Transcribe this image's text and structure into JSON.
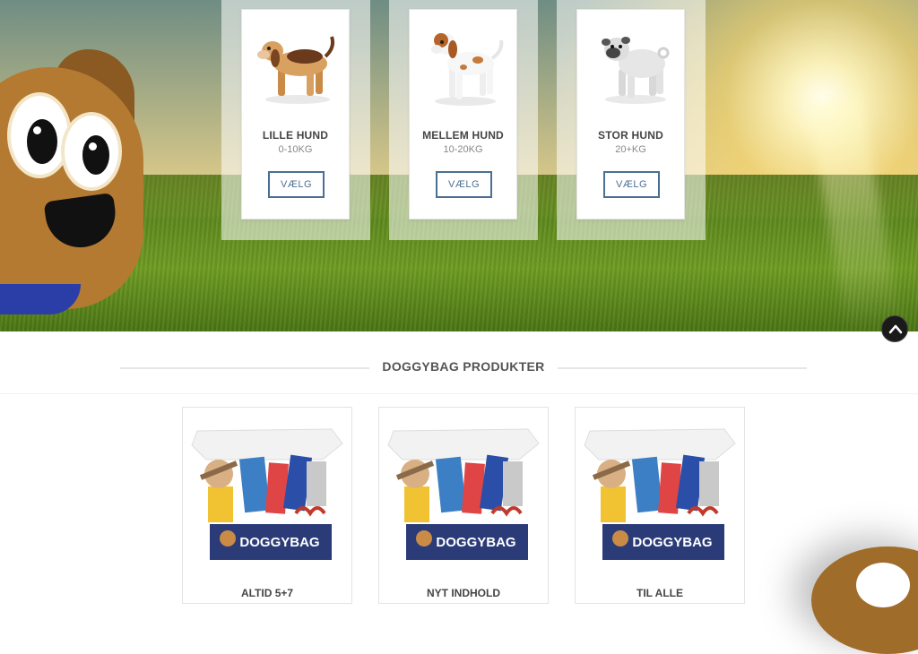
{
  "hero": {
    "sizes": [
      {
        "name": "LILLE HUND",
        "weight": "0-10KG",
        "button": "VÆLG",
        "dog": "beagle-icon"
      },
      {
        "name": "MELLEM HUND",
        "weight": "10-20KG",
        "button": "VÆLG",
        "dog": "spaniel-icon"
      },
      {
        "name": "STOR HUND",
        "weight": "20+KG",
        "button": "VÆLG",
        "dog": "pug-icon"
      }
    ]
  },
  "scroll_top": {
    "icon": "chevron-up-icon"
  },
  "products_section": {
    "title": "DOGGYBAG PRODUKTER",
    "items": [
      {
        "caption": "ALTID 5+7",
        "brand": "DOGGYBAG"
      },
      {
        "caption": "NYT INDHOLD",
        "brand": "DOGGYBAG"
      },
      {
        "caption": "TIL ALLE",
        "brand": "DOGGYBAG"
      }
    ]
  },
  "colors": {
    "accent": "#4b6f92",
    "text_dark": "#444444",
    "text_muted": "#888888",
    "collar": "#2b3ea8",
    "mascot_brown": "#b47a32"
  }
}
